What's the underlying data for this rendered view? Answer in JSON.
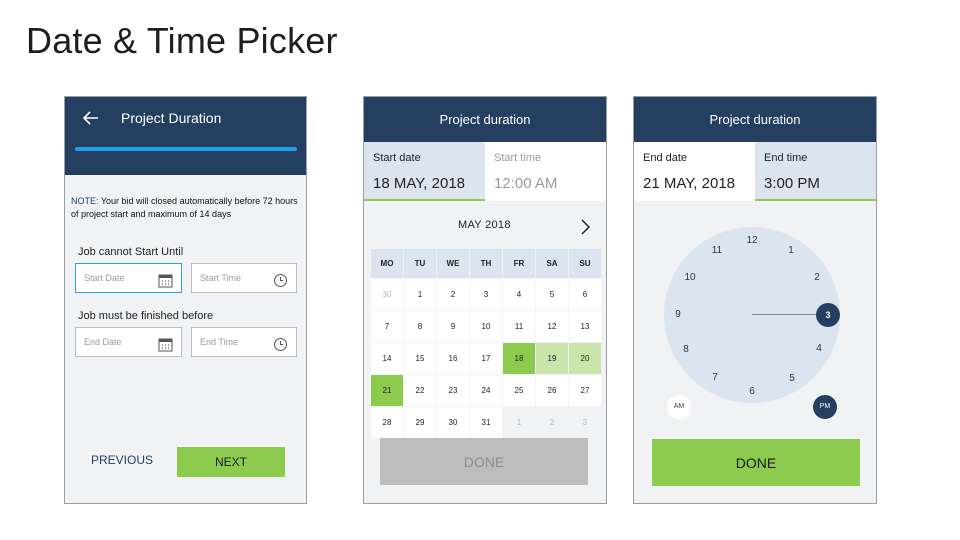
{
  "page_title": "Date & Time Picker",
  "screen1": {
    "title": "Project Duration",
    "note_prefix": "NOTE:",
    "note_text": " Your bid will closed automatically before 72 hours of project start and maximum of 14 days",
    "start_label": "Job cannot Start Until",
    "start_date_placeholder": "Start Date",
    "start_time_placeholder": "Start Time",
    "finish_label": "Job must be finished before",
    "end_date_placeholder": "End Date",
    "end_time_placeholder": "End Time",
    "previous_label": "PREVIOUS",
    "next_label": "NEXT"
  },
  "screen2": {
    "title": "Project duration",
    "tab_start_label": "Start date",
    "tab_start_value": "18 MAY, 2018",
    "tab_time_label": "Start time",
    "tab_time_value": "12:00 AM",
    "month_label": "MAY 2018",
    "weekdays": [
      "MO",
      "TU",
      "WE",
      "TH",
      "FR",
      "SA",
      "SU"
    ],
    "weeks": [
      [
        "30",
        "1",
        "2",
        "3",
        "4",
        "5",
        "6"
      ],
      [
        "7",
        "8",
        "9",
        "10",
        "11",
        "12",
        "13"
      ],
      [
        "14",
        "15",
        "16",
        "17",
        "18",
        "19",
        "20"
      ],
      [
        "21",
        "22",
        "23",
        "24",
        "25",
        "26",
        "27"
      ],
      [
        "28",
        "29",
        "30",
        "31",
        "1",
        "2",
        "3"
      ]
    ],
    "done_label": "DONE"
  },
  "screen3": {
    "title": "Project duration",
    "tab_end_label": "End date",
    "tab_end_value": "21 MAY, 2018",
    "tab_time_label": "End time",
    "tab_time_value": "3:00 PM",
    "clock_numbers": [
      "12",
      "1",
      "2",
      "3",
      "4",
      "5",
      "6",
      "7",
      "8",
      "9",
      "10",
      "11"
    ],
    "selected_hour": "3",
    "am_label": "AM",
    "pm_label": "PM",
    "done_label": "DONE"
  },
  "colors": {
    "header": "#243f5f",
    "accent_green": "#8ccb4e",
    "light_green": "#c9e4a8",
    "progress": "#1da1e6",
    "selected_tab": "#dbe4ef"
  }
}
